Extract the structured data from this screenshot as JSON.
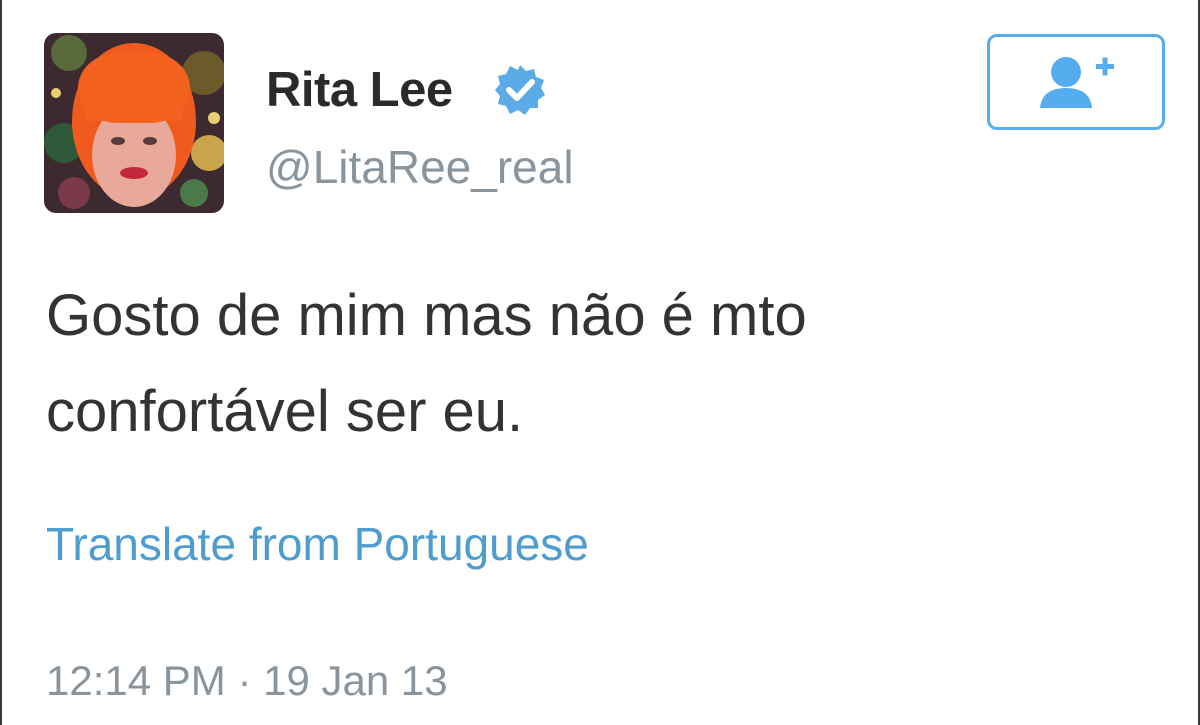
{
  "user": {
    "display_name": "Rita Lee",
    "handle": "@LitaRee_real",
    "verified": true
  },
  "follow_button": {
    "icon": "add-user-icon",
    "accent_color": "#55acee"
  },
  "tweet": {
    "text_lines": [
      "Gosto de mim mas não é mto",
      "confortável ser eu."
    ],
    "translate_label": "Translate from Portuguese",
    "time": "12:14 PM",
    "separator": "·",
    "date": "19 Jan 13"
  },
  "colors": {
    "link": "#4f9cce",
    "verified_badge": "#5aabe6",
    "secondary_text": "#8a949c"
  }
}
